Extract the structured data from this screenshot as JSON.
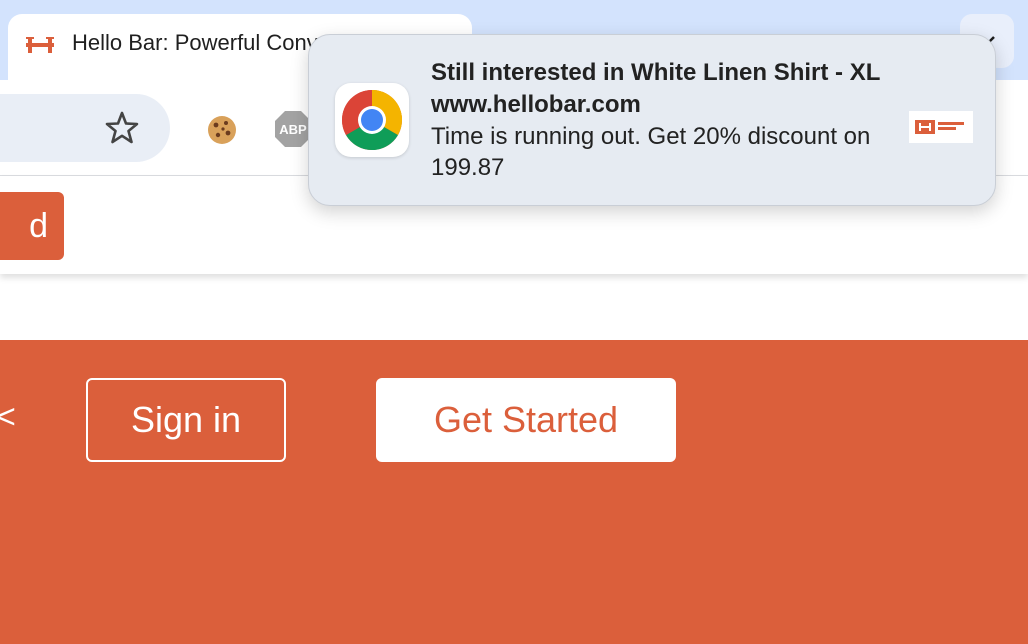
{
  "browser": {
    "tab_title": "Hello Bar: Powerful Conversion Tools",
    "abp_label": "ABP"
  },
  "page": {
    "hellobar_cta_partial": "d",
    "signin_label": "Sign in",
    "get_started_label": "Get Started",
    "edge_glyph": "<"
  },
  "notification": {
    "title": "Still interested in White Linen Shirt - XL",
    "origin": "www.hellobar.com",
    "body": "Time is running out. Get 20% discount on 199.87",
    "icon": "chrome-icon",
    "thumbnail": "hellobar-logo-icon"
  },
  "colors": {
    "brand": "#db5f3b",
    "tabstrip": "#d3e3fd",
    "notification_bg": "#e6ebf2"
  }
}
